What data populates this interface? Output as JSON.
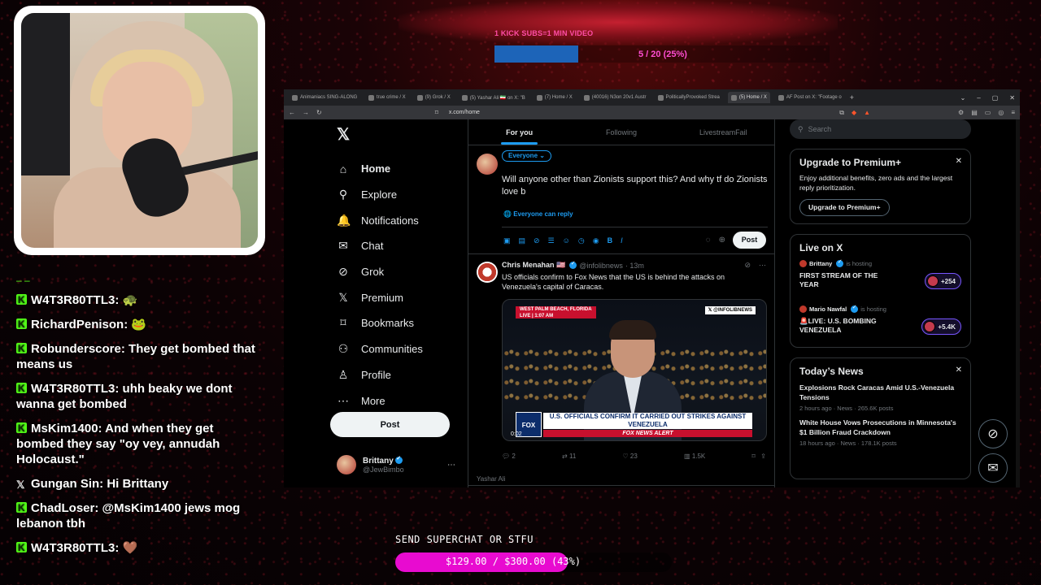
{
  "overlay": {
    "goal_title": "1 KICK SUBS=1 MIN VIDEO",
    "goal_progress": "5 / 20 (25%)",
    "goal_fraction": 0.25,
    "superchat_label": "SEND SUPERCHAT OR STFU",
    "superchat_progress": "$129.00 / $300.00 (43%)",
    "superchat_fraction": 0.43
  },
  "chat": [
    {
      "platform": "kick",
      "user": "W4T3R80TTL3:",
      "text": "🐢"
    },
    {
      "platform": "kick",
      "user": "RichardPenison:",
      "text": "🐸"
    },
    {
      "platform": "kick",
      "user": "Robunderscore:",
      "text": "They get bombed that means us"
    },
    {
      "platform": "kick",
      "user": "W4T3R80TTL3:",
      "text": "uhh beaky we dont wanna get bombed"
    },
    {
      "platform": "kick",
      "user": "MsKim1400:",
      "text": "And when they get bombed they say \"oy vey, annudah Holocaust.\""
    },
    {
      "platform": "x",
      "user": "Gungan Sin:",
      "text": "Hi Brittany"
    },
    {
      "platform": "kick",
      "user": "ChadLoser:",
      "text": "@MsKim1400 jews mog lebanon tbh"
    },
    {
      "platform": "kick",
      "user": "W4T3R80TTL3:",
      "text": "🤎"
    }
  ],
  "browser": {
    "tabs": [
      {
        "title": "Animaniacs SING-ALONG",
        "active": false
      },
      {
        "title": "true crime / X",
        "active": false
      },
      {
        "title": "(9) Grok / X",
        "active": false
      },
      {
        "title": "(5) Yashar Ali 🇮🇷 on X: \"B",
        "active": false
      },
      {
        "title": "(7) Home / X",
        "active": false
      },
      {
        "title": "(40016) N3on 20v1 Austr",
        "active": false
      },
      {
        "title": "PoliticallyProvoked Strea",
        "active": false
      },
      {
        "title": "(5) Home / X",
        "active": true
      },
      {
        "title": "AF Post on X: \"Footage o",
        "active": false
      }
    ],
    "url": "x.com/home"
  },
  "nav": {
    "items": [
      {
        "icon": "home-icon",
        "glyph": "⌂",
        "label": "Home"
      },
      {
        "icon": "search-icon",
        "glyph": "⚲",
        "label": "Explore"
      },
      {
        "icon": "bell-icon",
        "glyph": "🔔",
        "label": "Notifications"
      },
      {
        "icon": "mail-icon",
        "glyph": "✉",
        "label": "Chat"
      },
      {
        "icon": "grok-icon",
        "glyph": "⊘",
        "label": "Grok"
      },
      {
        "icon": "x-logo-icon",
        "glyph": "𝕏",
        "label": "Premium"
      },
      {
        "icon": "bookmark-icon",
        "glyph": "⌑",
        "label": "Bookmarks"
      },
      {
        "icon": "communities-icon",
        "glyph": "⚇",
        "label": "Communities"
      },
      {
        "icon": "person-icon",
        "glyph": "♙",
        "label": "Profile"
      },
      {
        "icon": "more-icon",
        "glyph": "⋯",
        "label": "More"
      }
    ],
    "post_label": "Post",
    "account_name": "Brittany",
    "account_handle": "@JewBimbo"
  },
  "timeline": {
    "tabs": [
      "For you",
      "Following",
      "LivestreamFail"
    ],
    "audience": "Everyone ⌄",
    "draft": "Will anyone other than Zionists support this? And why tf do Zionists love b",
    "reply_setting": "Everyone can reply",
    "post_label": "Post",
    "tweet": {
      "name": "Chris Menahan 🇺🇸",
      "handle": "@infolibnews",
      "time": "· 13m",
      "text": "US officials confirm to Fox News that the US is behind the attacks on Venezuela's capital of Caracas.",
      "media": {
        "location": "WEST PALM BEACH, FLORIDA",
        "live": "LIVE | 1:07 AM",
        "tag": "𝕏 @INFOLIBNEWS",
        "network": "FOX NEWS",
        "headline": "U.S. OFFICIALS CONFIRM IT CARRIED OUT STRIKES AGAINST VENEZUELA",
        "alert": "FOX NEWS ALERT",
        "duration": "0:02"
      },
      "replies": "2",
      "reposts": "11",
      "likes": "23",
      "views": "1.5K"
    },
    "next_author": "Yashar Ali"
  },
  "sidebar": {
    "search_placeholder": "Search",
    "premium": {
      "title": "Upgrade to Premium+",
      "body": "Enjoy additional benefits, zero ads and the largest reply prioritization.",
      "button": "Upgrade to Premium+"
    },
    "live": {
      "title": "Live on X",
      "items": [
        {
          "host": "Brittany",
          "status": "is hosting",
          "title": "FIRST STREAM OF THE YEAR",
          "count": "+254"
        },
        {
          "host": "Mario Nawfal",
          "status": "is hosting",
          "title": "🚨LIVE: U.S. BOMBING VENEZUELA",
          "count": "+5.4K"
        }
      ]
    },
    "news": {
      "title": "Today’s News",
      "items": [
        {
          "title": "Explosions Rock Caracas Amid U.S.-Venezuela Tensions",
          "meta": "2 hours ago · News · 265.6K posts"
        },
        {
          "title": "White House Vows Prosecutions in Minnesota's $1 Billion Fraud Crackdown",
          "meta": "18 hours ago · News · 178.1K posts"
        }
      ]
    }
  }
}
